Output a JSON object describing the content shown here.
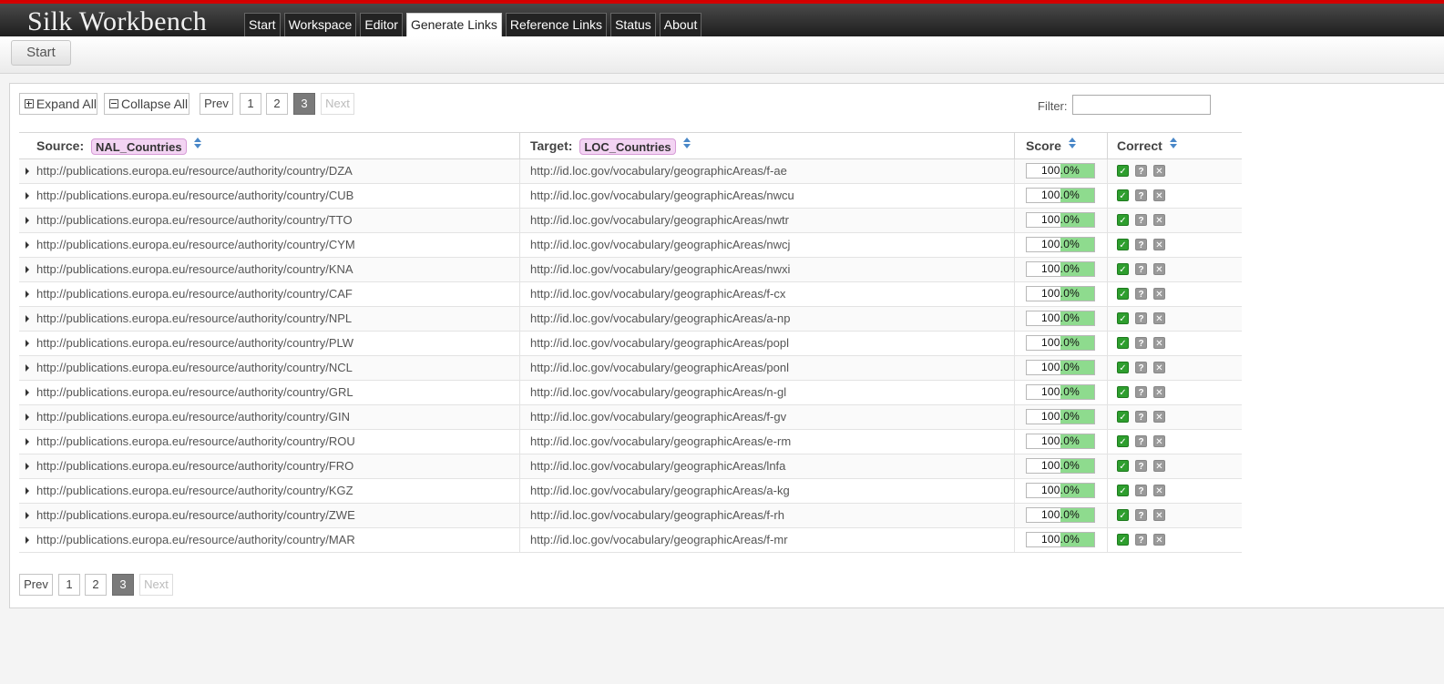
{
  "app": {
    "title": "Silk Workbench"
  },
  "nav": [
    {
      "label": "Start",
      "active": false
    },
    {
      "label": "Workspace",
      "active": false
    },
    {
      "label": "Editor",
      "active": false
    },
    {
      "label": "Generate Links",
      "active": true
    },
    {
      "label": "Reference Links",
      "active": false
    },
    {
      "label": "Status",
      "active": false
    },
    {
      "label": "About",
      "active": false
    }
  ],
  "breadcrumb": {
    "start_label": "Start"
  },
  "toolbar": {
    "expand_all": "Expand All",
    "collapse_all": "Collapse All"
  },
  "pagination": {
    "prev": "Prev",
    "pages": [
      "1",
      "2",
      "3"
    ],
    "current": "3",
    "next": "Next"
  },
  "filter": {
    "label": "Filter:",
    "value": ""
  },
  "table": {
    "headers": {
      "source_label": "Source:",
      "source_dataset": "NAL_Countries",
      "target_label": "Target:",
      "target_dataset": "LOC_Countries",
      "score": "Score",
      "correct": "Correct"
    },
    "score_display": "100.0%",
    "score_fraction": 1.0,
    "rows": [
      {
        "source": "http://publications.europa.eu/resource/authority/country/DZA",
        "target": "http://id.loc.gov/vocabulary/geographicAreas/f-ae"
      },
      {
        "source": "http://publications.europa.eu/resource/authority/country/CUB",
        "target": "http://id.loc.gov/vocabulary/geographicAreas/nwcu"
      },
      {
        "source": "http://publications.europa.eu/resource/authority/country/TTO",
        "target": "http://id.loc.gov/vocabulary/geographicAreas/nwtr"
      },
      {
        "source": "http://publications.europa.eu/resource/authority/country/CYM",
        "target": "http://id.loc.gov/vocabulary/geographicAreas/nwcj"
      },
      {
        "source": "http://publications.europa.eu/resource/authority/country/KNA",
        "target": "http://id.loc.gov/vocabulary/geographicAreas/nwxi"
      },
      {
        "source": "http://publications.europa.eu/resource/authority/country/CAF",
        "target": "http://id.loc.gov/vocabulary/geographicAreas/f-cx"
      },
      {
        "source": "http://publications.europa.eu/resource/authority/country/NPL",
        "target": "http://id.loc.gov/vocabulary/geographicAreas/a-np"
      },
      {
        "source": "http://publications.europa.eu/resource/authority/country/PLW",
        "target": "http://id.loc.gov/vocabulary/geographicAreas/popl"
      },
      {
        "source": "http://publications.europa.eu/resource/authority/country/NCL",
        "target": "http://id.loc.gov/vocabulary/geographicAreas/ponl"
      },
      {
        "source": "http://publications.europa.eu/resource/authority/country/GRL",
        "target": "http://id.loc.gov/vocabulary/geographicAreas/n-gl"
      },
      {
        "source": "http://publications.europa.eu/resource/authority/country/GIN",
        "target": "http://id.loc.gov/vocabulary/geographicAreas/f-gv"
      },
      {
        "source": "http://publications.europa.eu/resource/authority/country/ROU",
        "target": "http://id.loc.gov/vocabulary/geographicAreas/e-rm"
      },
      {
        "source": "http://publications.europa.eu/resource/authority/country/FRO",
        "target": "http://id.loc.gov/vocabulary/geographicAreas/lnfa"
      },
      {
        "source": "http://publications.europa.eu/resource/authority/country/KGZ",
        "target": "http://id.loc.gov/vocabulary/geographicAreas/a-kg"
      },
      {
        "source": "http://publications.europa.eu/resource/authority/country/ZWE",
        "target": "http://id.loc.gov/vocabulary/geographicAreas/f-rh"
      },
      {
        "source": "http://publications.europa.eu/resource/authority/country/MAR",
        "target": "http://id.loc.gov/vocabulary/geographicAreas/f-mr"
      }
    ]
  },
  "icons": {
    "correct": "check-icon",
    "unknown": "question-icon",
    "incorrect": "close-icon",
    "expand": "triangle-right-icon",
    "sort": "sort-arrows-icon"
  },
  "colors": {
    "accent_red": "#d40000",
    "score_fill": "#8edb8e",
    "dataset_pill": "#f3d4f3",
    "check_green": "#2e9e2e",
    "page_current": "#7a7a7a"
  }
}
